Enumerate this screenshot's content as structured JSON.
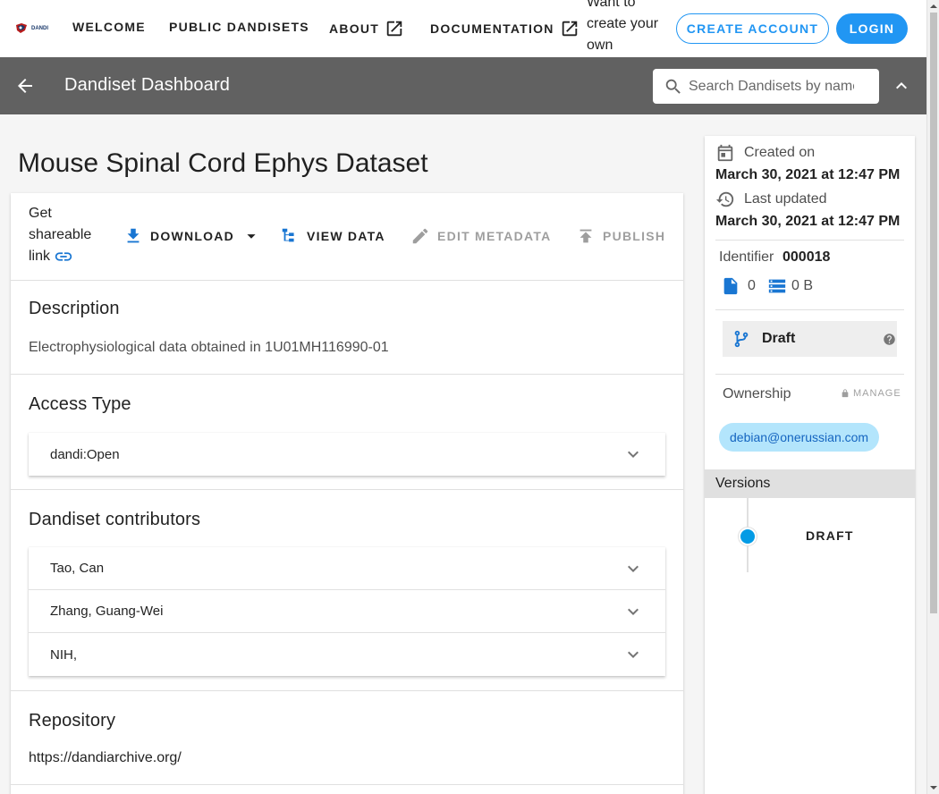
{
  "topnav": {
    "logo_text": "DANDI",
    "links": [
      "WELCOME",
      "PUBLIC DANDISETS",
      "ABOUT",
      "DOCUMENTATION"
    ],
    "promo": "Want to create your own datasets?",
    "create_account": "CREATE ACCOUNT",
    "login": "LOGIN"
  },
  "subheader": {
    "title": "Dandiset Dashboard",
    "search_placeholder": "Search Dandisets by name, description, identifier, or contributor name"
  },
  "dandiset": {
    "title": "Mouse Spinal Cord Ephys Dataset",
    "toolbar": {
      "share": "Get shareable link",
      "download": "DOWNLOAD",
      "view_data": "VIEW DATA",
      "edit_metadata": "EDIT METADATA",
      "publish": "PUBLISH"
    },
    "description_heading": "Description",
    "description": "Electrophysiological data obtained in 1U01MH116990-01",
    "access_heading": "Access Type",
    "access_type": "dandi:Open",
    "contributors_heading": "Dandiset contributors",
    "contributors": [
      "Tao, Can",
      "Zhang, Guang-Wei",
      "NIH,"
    ],
    "repository_heading": "Repository",
    "repository": "https://dandiarchive.org/"
  },
  "sidebar": {
    "created_label": "Created on",
    "created_date": "March 30, 2021 at 12:47 PM",
    "updated_label": "Last updated",
    "updated_date": "March 30, 2021 at 12:47 PM",
    "identifier_label": "Identifier",
    "identifier": "000018",
    "file_count": "0",
    "size": "0 B",
    "status": "Draft",
    "ownership_label": "Ownership",
    "manage_label": "MANAGE",
    "owner": "debian@onerussian.com",
    "versions_label": "Versions",
    "version": "DRAFT"
  },
  "colors": {
    "primary": "#2196f3",
    "subheader_bg": "#616161",
    "accent_icon": "#039be5",
    "chip_bg": "#b3e5fc"
  }
}
